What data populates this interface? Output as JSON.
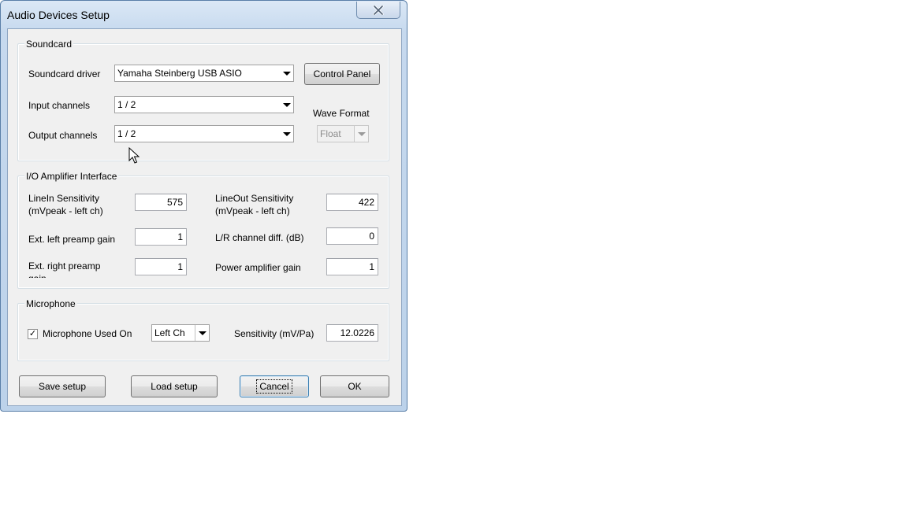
{
  "window": {
    "title": "Audio Devices Setup",
    "close_glyph": "✕"
  },
  "soundcard": {
    "legend": "Soundcard",
    "driver_label": "Soundcard driver",
    "driver_value": "Yamaha Steinberg USB ASIO",
    "control_panel_label": "Control Panel",
    "input_label": "Input channels",
    "input_value": "1 / 2",
    "output_label": "Output channels",
    "output_value": "1 / 2",
    "wave_format_label": "Wave Format",
    "wave_format_value": "Float"
  },
  "io": {
    "legend": "I/O Amplifier Interface",
    "linein_label_1": "LineIn Sensitivity",
    "linein_label_2": "(mVpeak - left ch)",
    "linein_value": "575",
    "lineout_label_1": "LineOut Sensitivity",
    "lineout_label_2": "(mVpeak - left ch)",
    "lineout_value": "422",
    "left_preamp_label": "Ext. left preamp gain",
    "left_preamp_value": "1",
    "lr_diff_label": "L/R channel diff. (dB)",
    "lr_diff_value": "0",
    "right_preamp_label": "Ext. right preamp",
    "right_preamp_label_2": "gain",
    "right_preamp_value": "1",
    "power_amp_label": "Power amplifier gain",
    "power_amp_value": "1"
  },
  "microphone": {
    "legend": "Microphone",
    "used_on_label": "Microphone Used On",
    "checked": true,
    "check_glyph": "✓",
    "channel_value": "Left Ch",
    "sensitivity_label": "Sensitivity (mV/Pa)",
    "sensitivity_value": "12.0226"
  },
  "buttons": {
    "save": "Save setup",
    "load": "Load setup",
    "cancel": "Cancel",
    "ok": "OK"
  },
  "icons": {
    "close": "close-icon",
    "dropdown": "chevron-down-icon",
    "cursor": "mouse-cursor-icon"
  }
}
